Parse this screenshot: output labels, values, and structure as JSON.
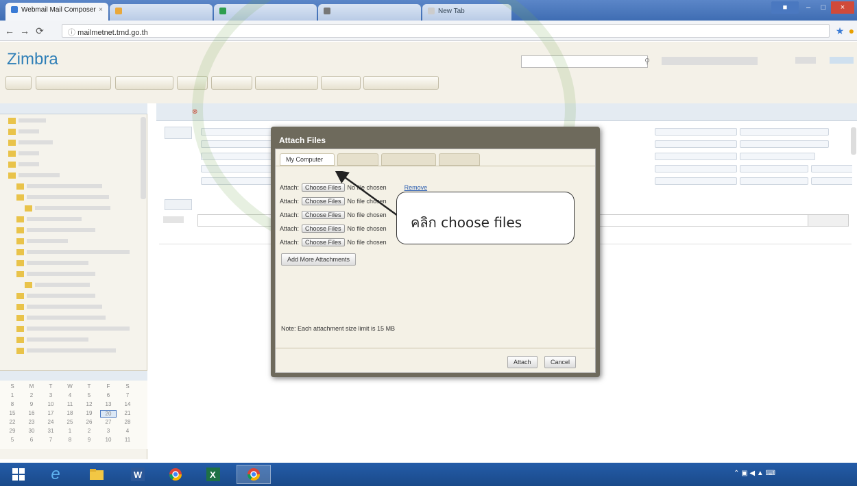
{
  "browser": {
    "tabs": [
      {
        "label": "Webmail Mail Composer",
        "active": true
      },
      {
        "label": "",
        "active": false
      },
      {
        "label": "",
        "active": false
      },
      {
        "label": "",
        "active": false
      },
      {
        "label": "New Tab",
        "active": false
      }
    ],
    "url": "mailmetnet.tmd.go.th"
  },
  "app": {
    "logo": "Zimbra"
  },
  "dialog": {
    "title": "Attach Files",
    "tabs": [
      "My Computer",
      "",
      "",
      ""
    ],
    "rows": [
      {
        "label": "Attach:",
        "button": "Choose Files",
        "status": "No file chosen",
        "remove": "Remove"
      },
      {
        "label": "Attach:",
        "button": "Choose Files",
        "status": "No file chosen",
        "remove": ""
      },
      {
        "label": "Attach:",
        "button": "Choose Files",
        "status": "No file chosen",
        "remove": ""
      },
      {
        "label": "Attach:",
        "button": "Choose Files",
        "status": "No file chosen",
        "remove": ""
      },
      {
        "label": "Attach:",
        "button": "Choose Files",
        "status": "No file chosen",
        "remove": ""
      }
    ],
    "add_more": "Add More Attachments",
    "note": "Note: Each attachment size limit is 15 MB",
    "attach_btn": "Attach",
    "cancel_btn": "Cancel"
  },
  "callout": {
    "text": "คลิก choose files"
  },
  "calendar": {
    "days": [
      "S",
      "M",
      "T",
      "W",
      "T",
      "F",
      "S"
    ],
    "weeks": [
      [
        "1",
        "2",
        "3",
        "4",
        "5",
        "6",
        "7"
      ],
      [
        "8",
        "9",
        "10",
        "11",
        "12",
        "13",
        "14"
      ],
      [
        "15",
        "16",
        "17",
        "18",
        "19",
        "20",
        "21"
      ],
      [
        "22",
        "23",
        "24",
        "25",
        "26",
        "27",
        "28"
      ],
      [
        "29",
        "30",
        "31",
        "1",
        "2",
        "3",
        "4"
      ],
      [
        "5",
        "6",
        "7",
        "8",
        "9",
        "10",
        "11"
      ]
    ]
  },
  "colors": {
    "zimbra_blue": "#2f7fb7",
    "taskbar": "#1f54a0",
    "dialog_frame": "#6e6a5c"
  },
  "icons": [
    "back-icon",
    "forward-icon",
    "reload-icon",
    "star-icon",
    "windows-start-icon",
    "ie-icon",
    "explorer-icon",
    "word-icon",
    "chrome-icon",
    "excel-icon"
  ]
}
